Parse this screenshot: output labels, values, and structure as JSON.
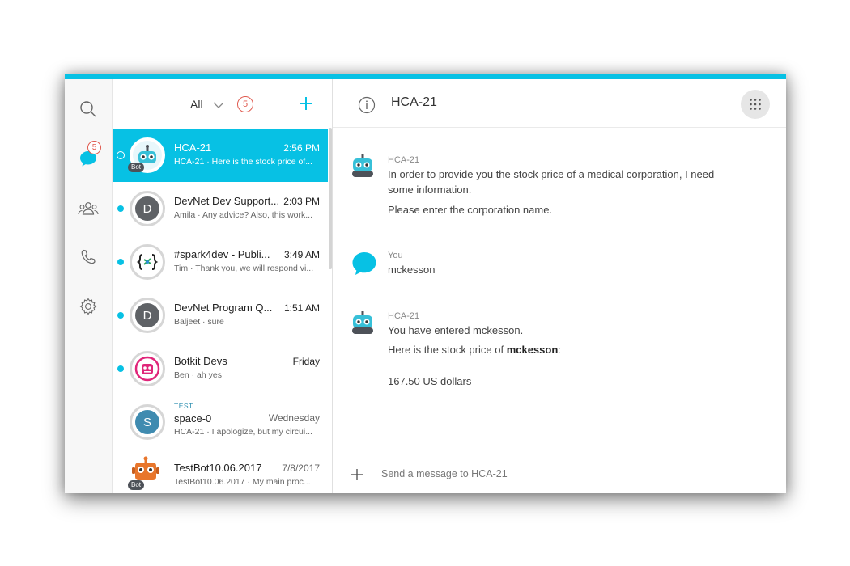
{
  "nav": {
    "chat_badge": "5"
  },
  "list": {
    "filter_label": "All",
    "filter_count": "5",
    "rows": [
      {
        "title": "HCA-21",
        "time": "2:56 PM",
        "sub": "HCA-21 · Here is the stock price of...",
        "bot_label": "Bot"
      },
      {
        "title": "DevNet Dev Support...",
        "time": "2:03 PM",
        "sub": "Amila · Any advice? Also, this work...",
        "initial": "D"
      },
      {
        "title": "#spark4dev - Publi...",
        "time": "3:49 AM",
        "sub": "Tim · Thank you, we will respond vi..."
      },
      {
        "title": "DevNet Program Q...",
        "time": "1:51 AM",
        "sub": "Baljeet · sure",
        "initial": "D"
      },
      {
        "title": "Botkit Devs",
        "time": "Friday",
        "sub": "Ben · ah yes"
      },
      {
        "tag": "TEST",
        "title": "space-0",
        "time": "Wednesday",
        "sub": "HCA-21 · I apologize, but my circui...",
        "initial": "S"
      },
      {
        "title": "TestBot10.06.2017",
        "time": "7/8/2017",
        "sub": "TestBot10.06.2017 · My main proc...",
        "bot_label": "Bot"
      }
    ]
  },
  "chat": {
    "title": "HCA-21",
    "messages": [
      {
        "sender": "HCA-21",
        "bot_label": "Bot",
        "lines": [
          "In order to provide you the stock price of a medical corporation, I need some information.",
          "Please enter the corporation name."
        ]
      },
      {
        "sender": "You",
        "lines": [
          "mckesson"
        ]
      },
      {
        "sender": "HCA-21",
        "bot_label": "Bot",
        "lines": [
          "You have entered mckesson.",
          "Here is the stock price of",
          "mckesson",
          ":",
          "167.50 US dollars"
        ]
      }
    ],
    "composer_placeholder": "Send a message to HCA-21"
  },
  "colors": {
    "accent": "#07c1e4",
    "badge": "#e05a4f",
    "avatar_gray": "#5f6266",
    "avatar_blue": "#3f8bb0"
  }
}
